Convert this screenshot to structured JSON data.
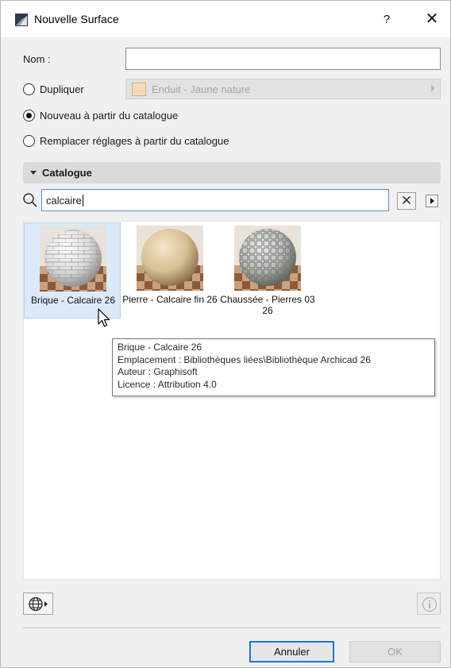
{
  "window": {
    "title": "Nouvelle Surface",
    "help_label": "?",
    "close_label": "✕"
  },
  "form": {
    "nom_label": "Nom :",
    "nom_value": "",
    "dupliquer_label": "Dupliquer",
    "dupliquer_value": "Enduit - Jaune nature",
    "dupliquer_swatch_color": "#f3dcb8",
    "nouveau_label": "Nouveau à partir du catalogue",
    "remplacer_label": "Remplacer réglages à partir du catalogue",
    "selected_option": "nouveau"
  },
  "catalogue": {
    "title": "Catalogue",
    "search_value": "calcaire",
    "clear_label": "✕",
    "items": [
      {
        "label": "Brique - Calcaire 26",
        "selected": true
      },
      {
        "label": "Pierre - Calcaire fin 26",
        "selected": false
      },
      {
        "label": "Chaussée - Pierres 03 26",
        "selected": false
      }
    ]
  },
  "tooltip": {
    "name": "Brique - Calcaire 26",
    "emplacement": "Emplacement : Bibliothèques liées\\Bibliothèque Archicad 26",
    "auteur": "Auteur : Graphisoft",
    "licence": "Licence : Attribution 4.0"
  },
  "footer": {
    "annuler_label": "Annuler",
    "ok_label": "OK",
    "ok_enabled": false
  },
  "colors": {
    "accent": "#0a66c9",
    "selection": "#dbe9f8"
  }
}
